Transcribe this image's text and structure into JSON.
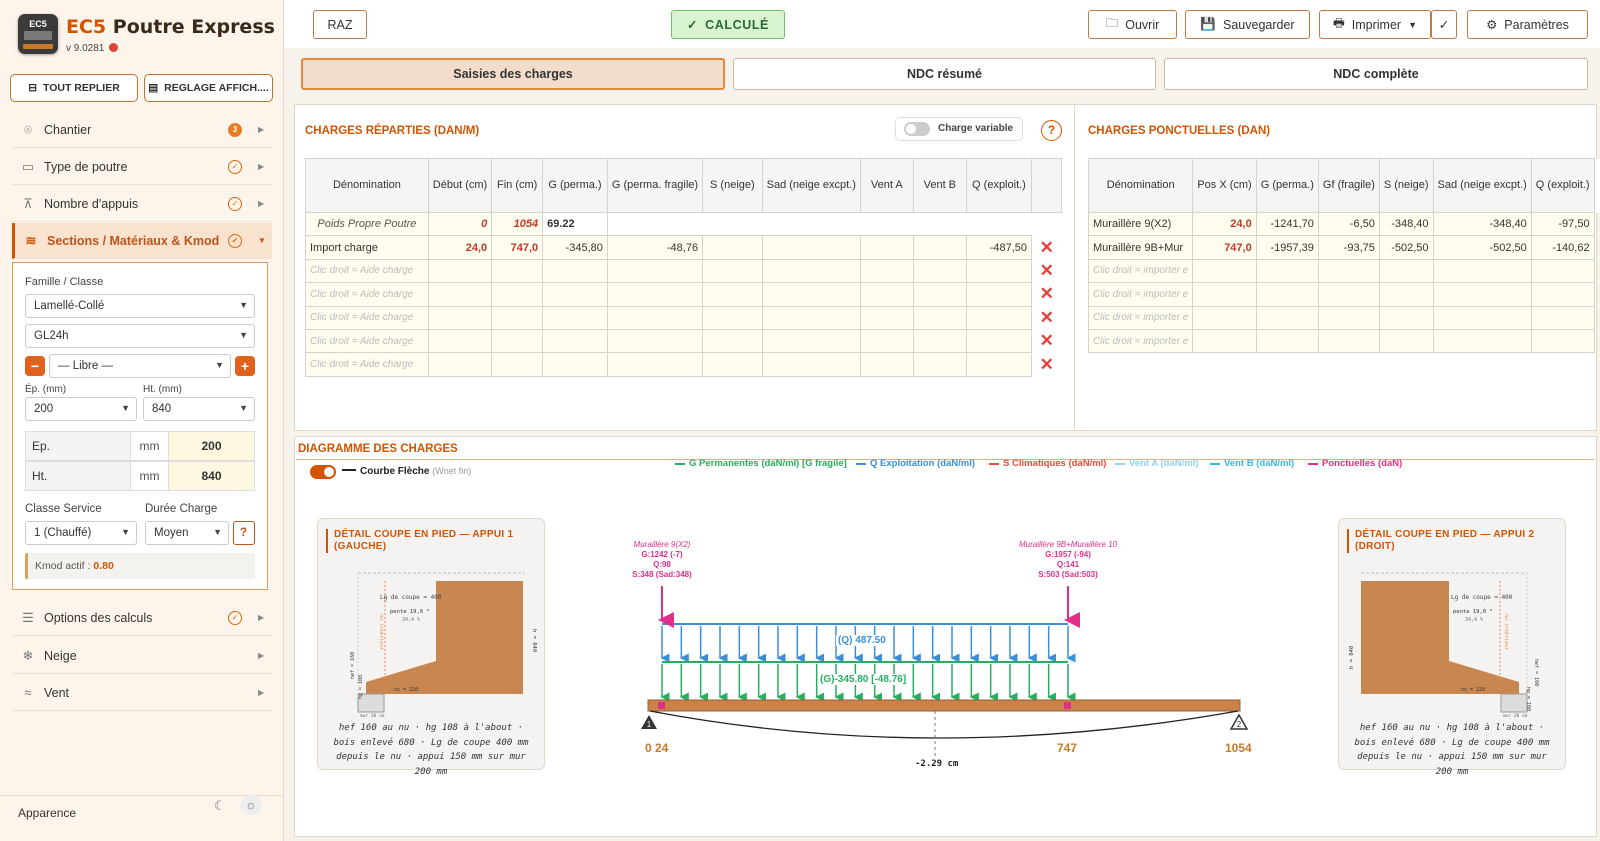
{
  "app": {
    "title_prefix": "EC5",
    "title_rest": " Poutre Express",
    "version": "v 9.0281",
    "logo_text": "EC5"
  },
  "sidebar": {
    "collapse_label": "TOUT REPLIER",
    "display_label": "REGLAGE AFFICH....",
    "items": [
      {
        "label": "Chantier",
        "badge": "3",
        "icon": "map-pin-icon"
      },
      {
        "label": "Type de poutre",
        "icon": "beam-icon"
      },
      {
        "label": "Nombre d'appuis",
        "icon": "supports-icon"
      },
      {
        "label": "Sections / Matériaux & Kmod",
        "icon": "layers-icon"
      },
      {
        "label": "Options des calculs",
        "icon": "sliders-icon"
      },
      {
        "label": "Neige",
        "icon": "snowflake-icon"
      },
      {
        "label": "Vent",
        "icon": "wind-icon"
      }
    ],
    "section_panel": {
      "family_label": "Famille / Classe",
      "family_value": "Lamellé-Collé",
      "class_value": "GL24h",
      "libre_value": "— Libre —",
      "ep_label": "Ép. (mm)",
      "ep_value": "200",
      "ht_label": "Ht. (mm)",
      "ht_value": "840",
      "dim_rows": [
        {
          "label": "Ep.",
          "unit": "mm",
          "value": "200"
        },
        {
          "label": "Ht.",
          "unit": "mm",
          "value": "840"
        }
      ],
      "service_label": "Classe Service",
      "service_value": "1 (Chauffé)",
      "duree_label": "Durée Charge",
      "duree_value": "Moyen",
      "help_label": "?",
      "kmod_label": "Kmod actif :",
      "kmod_value": "0.80"
    },
    "appearance_label": "Apparence"
  },
  "toolbar": {
    "raz": "RAZ",
    "status": "CALCULÉ",
    "open": "Ouvrir",
    "save": "Sauvegarder",
    "print": "Imprimer",
    "settings": "Paramètres"
  },
  "tabs": [
    "Saisies des charges",
    "NDC résumé",
    "NDC complète"
  ],
  "reparties": {
    "title": "CHARGES RÉPARTIES (DAN/M)",
    "variable_label": "Charge variable",
    "help": "?",
    "headers": [
      "Dénomination",
      "Début (cm)",
      "Fin (cm)",
      "G (perma.)",
      "G (perma. fragile)",
      "S (neige)",
      "Sad (neige excpt.)",
      "Vent A",
      "Vent B",
      "Q (exploit.)"
    ],
    "row_pp": {
      "name": "Poids Propre Poutre",
      "debut": "0",
      "fin": "1054",
      "g": "69.22"
    },
    "row_import": {
      "name": "Import charge",
      "debut": "24,0",
      "fin": "747,0",
      "g": "-345,80",
      "gf": "-48,76",
      "q": "-487,50"
    },
    "placeholder": "Clic droit = Aide charge"
  },
  "ponctuelles": {
    "title": "CHARGES PONCTUELLES (DAN)",
    "headers": [
      "Dénomination",
      "Pos X (cm)",
      "G (perma.)",
      "Gf (fragile)",
      "S (neige)",
      "Sad (neige excpt.)",
      "Q (exploit.)"
    ],
    "rows": [
      {
        "name": "Muraillère 9(X2)",
        "pos": "24,0",
        "g": "-1241,70",
        "gf": "-6,50",
        "s": "-348,40",
        "sad": "-348,40",
        "q": "-97,50"
      },
      {
        "name": "Muraillère 9B+Mur",
        "pos": "747,0",
        "g": "-1957,39",
        "gf": "-93,75",
        "s": "-502,50",
        "sad": "-502,50",
        "q": "-140,62"
      }
    ],
    "placeholder": "Clic droit = importer  e"
  },
  "diagram": {
    "title": "DIAGRAMME DES CHARGES",
    "curve_label": "Courbe Flèche",
    "curve_sub": "(Wnet fin)",
    "legend": [
      {
        "label": "G Permanentes (daN/ml) [G fragile]",
        "color": "#27ae60"
      },
      {
        "label": "Q Exploitation (daN/ml)",
        "color": "#3a8fd9"
      },
      {
        "label": "S Climatiques (daN/ml)",
        "color": "#e74c3c"
      },
      {
        "label": "Vent A (daN/ml)",
        "color": "#8fd3ef"
      },
      {
        "label": "Vent B (daN/ml)",
        "color": "#3ab7e0"
      },
      {
        "label": "Ponctuelles (daN)",
        "color": "#e0308a"
      }
    ],
    "point1": {
      "name": "Muraillère 9(X2)",
      "g": "G:1242 (-7)",
      "q": "Q:98",
      "s": "S:348 (Sad:348)"
    },
    "point2": {
      "name": "Muraillère 9B+Muraillère 10",
      "g": "G:1957 (-94)",
      "q": "Q:141",
      "s": "S:503 (Sad:503)"
    },
    "q_label": "(Q) 487.50",
    "g_label": "(G)-345.80 [-48.76]",
    "pos_start": "0 24",
    "pos_mid": "747",
    "pos_end": "1054",
    "deflection": "-2.29 cm",
    "support1_num": "1",
    "support2_num": "2",
    "detail_left": {
      "title1": "DÉTAIL COUPE EN PIED — APPUI 1",
      "title2": "(GAUCHE)",
      "cap": "hef 160 au nu · hg 108 à l'about · bois enlevé 680 · Lg de coupe 400 mm depuis le nu · appui 150 mm sur mur 200 mm",
      "lg": "Lg de coupe = 400",
      "pente1": "pente 19,0 °",
      "pente2": "34,4 %",
      "h": "h = 840",
      "int": "nu intérieur",
      "hef": "hef = 160",
      "hg": "hg = 108",
      "hs": "hs = 220",
      "mur": "mur 20 cm"
    },
    "detail_right": {
      "title1": "DÉTAIL COUPE EN PIED — APPUI 2",
      "title2": "(DROIT)",
      "cap": "hef 160 au nu · hg 108 à l'about · bois enlevé 680 · Lg de coupe 400 mm depuis le nu · appui 150 mm sur mur 200 mm",
      "lg": "Lg de coupe = 400",
      "pente1": "pente 19,0 °",
      "pente2": "34,4 %",
      "h": "h = 840",
      "int": "nu intérieur",
      "hef": "hef = 160",
      "hg": "hg = 108",
      "hs": "hs = 220",
      "mur": "mur 20 cm"
    }
  },
  "colors": {
    "accent": "#d35400",
    "wood": "#c8824a",
    "g_line": "#27ae60",
    "q_line": "#3a8fd9",
    "point": "#e0308a",
    "delete": "#e0433a"
  }
}
